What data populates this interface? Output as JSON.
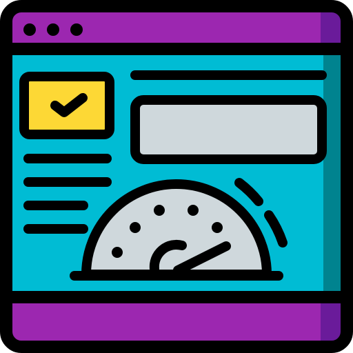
{
  "icon": {
    "name": "browser-speed-dashboard-icon",
    "colors": {
      "frame_purple": "#9C27B0",
      "frame_purple_shade": "#6A1B9A",
      "content_cyan": "#00BCD4",
      "content_cyan_shade": "#00838F",
      "checkbox_yellow": "#FDD835",
      "gray_fill": "#CFD8DC",
      "outline": "#000000"
    }
  }
}
